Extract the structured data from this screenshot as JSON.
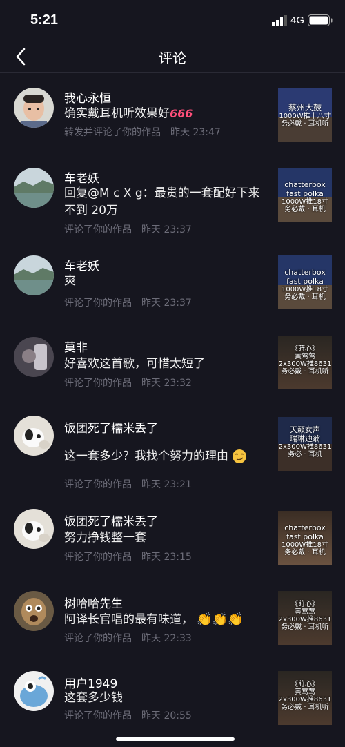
{
  "status_bar": {
    "time": "5:21",
    "network": "4G"
  },
  "nav": {
    "title": "评论"
  },
  "comments": [
    {
      "username": "我心永恒",
      "text": "确实戴耳机听效果好",
      "emoji": "666",
      "action": "转发并评论了你的作品",
      "time": "昨天 23:47",
      "thumb_lines": [
        "蔡州大鼓",
        "1000W推十八寸",
        "务必戴 · 耳机听"
      ]
    },
    {
      "username": "车老妖",
      "text": "回复@M c X g：最贵的一套配好下来不到 20万",
      "action": "评论了你的作品",
      "time": "昨天 23:37",
      "thumb_lines": [
        "chatterbox",
        "fast polka",
        "1000W推18寸",
        "务必戴 · 耳机"
      ]
    },
    {
      "username": "车老妖",
      "text": "爽",
      "action": "评论了你的作品",
      "time": "昨天 23:37",
      "thumb_lines": [
        "chatterbox",
        "fast polka",
        "1000W推18寸",
        "务必戴 · 耳机"
      ]
    },
    {
      "username": "莫非",
      "text": "好喜欢这首歌，可惜太短了",
      "action": "评论了你的作品",
      "time": "昨天 23:32",
      "thumb_lines": [
        "《莳心》",
        "黄莺莺",
        "2x300W推8631",
        "务必戴 · 耳机听"
      ]
    },
    {
      "username": "饭团死了糯米丢了",
      "text": "这一套多少？我找个努力的理由",
      "action": "评论了你的作品",
      "time": "昨天 23:21",
      "thumb_lines": [
        "天籁女声",
        "瑞琳迪翁",
        "2x300W推8631",
        "务必 · 耳机"
      ]
    },
    {
      "username": "饭团死了糯米丢了",
      "text": "努力挣钱整一套",
      "action": "评论了你的作品",
      "time": "昨天 23:15",
      "thumb_lines": [
        "chatterbox",
        "fast polka",
        "1000W推18寸",
        "务必戴 · 耳机"
      ]
    },
    {
      "username": "树哈哈先生",
      "text": "阿译长官唱的最有味道，",
      "action": "评论了你的作品",
      "time": "昨天 22:33",
      "thumb_lines": [
        "《莳心》",
        "黄莺莺",
        "2x300W推8631",
        "务必戴 · 耳机听"
      ]
    },
    {
      "username": "用户1949",
      "text": "这套多少钱",
      "action": "评论了你的作品",
      "time": "昨天 20:55",
      "thumb_lines": [
        "《莳心》",
        "黄莺莺",
        "2x300W推8631",
        "务必戴 · 耳机听"
      ]
    }
  ],
  "colors": {
    "background": "#16161f",
    "meta_text": "#6c6c78",
    "emoji_666": "#ff4f7a"
  }
}
